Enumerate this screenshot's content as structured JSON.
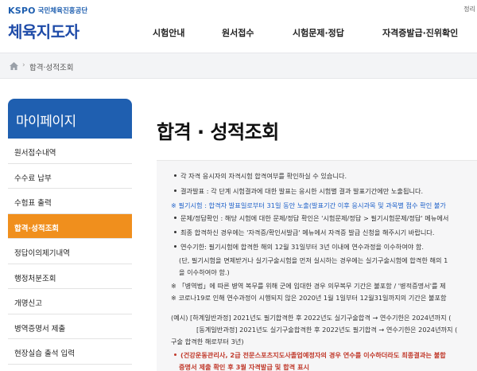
{
  "header": {
    "logo_kspo": "KSPO",
    "logo_org": "국민체육진흥공단",
    "site_title": "체육지도자",
    "util_text": "정리",
    "nav": [
      "시험안내",
      "원서접수",
      "시험문제·정답",
      "자격증발급·진위확인"
    ]
  },
  "breadcrumb": {
    "separator": "›",
    "current": "합격·성적조회"
  },
  "sidebar": {
    "title": "마이페이지",
    "items": [
      {
        "label": "원서접수내역"
      },
      {
        "label": "수수료 납부"
      },
      {
        "label": "수험표 출력"
      },
      {
        "label": "합격·성적조회"
      },
      {
        "label": "정답이의제기내역"
      },
      {
        "label": "행정처분조회"
      },
      {
        "label": "개명신고"
      },
      {
        "label": "병역증명서 제출"
      },
      {
        "label": "현장실습 출석 입력"
      }
    ],
    "active_index": 3
  },
  "main": {
    "title": "합격 · 성적조회",
    "notices": [
      "각 자격 응시자의 자격시험 합격여부를 확인하실 수 있습니다.",
      "결과발표 : 각 단계 시험결과에 대한 발표는 응시한 시험별 결과 발표기간에만 노출됩니다.",
      "※ 필기시험 : 합격자 발표일로부터 31일 동안 노출(발표기간 이후 응시과목 및 과목별 점수 확인 불가",
      "문제/정답확인 : 해당 시험에 대한 문제/정답 확인은 '시험문제/정답 > 필기시험문제/정답' 메뉴에서",
      "최종 합격하신 경우에는 '자격증/확인서발급' 메뉴에서 자격증 발급 신청을 해주시기 바랍니다.",
      "연수기한: 필기시험에 합격한 해의 12월 31일부터 3년 이내에 연수과정을 이수하여야 함.",
      "(단, 필기시험을 면제받거나 실기구술시험을 먼저 실시하는 경우에는 실기구술시험에 합격한 해의 1",
      "을 이수하여야 함.)",
      "※ 「병역법」에 따른 병역 복무를 위해 군에 입대한 경우 의무복무 기간은 불포함 / '병적증명서'를 제",
      "※ 코로나19로 인해 연수과정이 시행되지 않은 2020년 1월 1일부터 12월31일까지의 기간은 불포함",
      "(예시) [하계일반과정] 2021년도 필기합격한 후 2022년도 실기구술합격 → 연수기한은 2024년까지 (",
      "[동계일반과정] 2021년도 실기구술합격한 후 2022년도 필기합격 → 연수기한은 2024년까지 (",
      "구술 합격한 해로부터 3년)",
      "(건강운동관리사, 2급 전문스포츠지도사졸업예정자의 경우 연수를 이수하더라도 최종결과는 불합",
      "증명서 제출 확인 후 3월 자격발급 및 합격 표시"
    ]
  },
  "colors": {
    "brand_blue": "#1f5fb0",
    "active_orange": "#f08f1d",
    "link_blue": "#2062c9"
  }
}
